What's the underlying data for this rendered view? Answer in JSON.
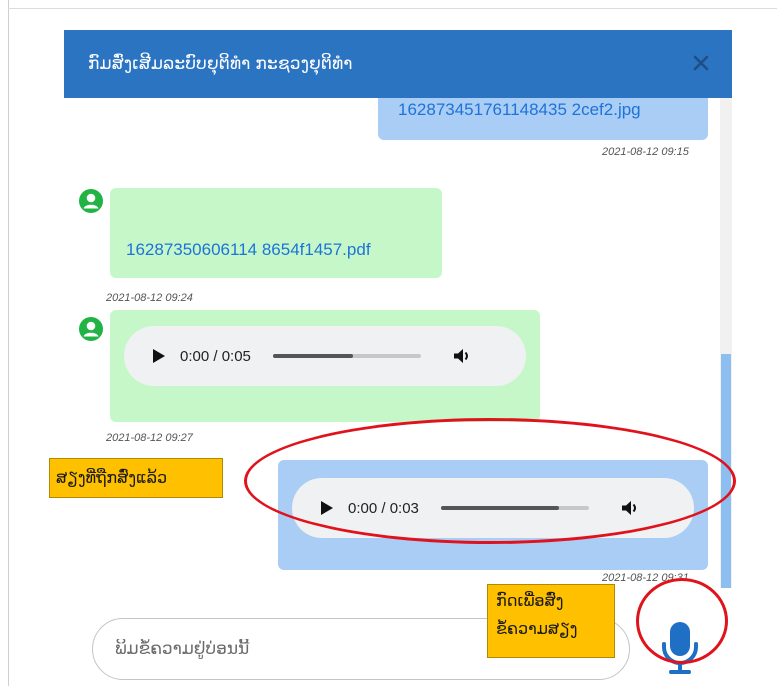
{
  "dialog": {
    "title": "ກົມສົ່ງເສີມລະບົບຍຸຕິທຳ ກະຊວງຍຸຕິທຳ",
    "close_icon": "close-icon",
    "header_color": "#2b74c2"
  },
  "messages": [
    {
      "direction": "sent",
      "kind": "file",
      "file_name": "162873451761148435 2cef2.jpg",
      "timestamp": "2021-08-12 09:15"
    },
    {
      "direction": "received",
      "kind": "file",
      "file_name": "16287350606114 8654f1457.pdf",
      "timestamp": "2021-08-12 09:24"
    },
    {
      "direction": "received",
      "kind": "audio",
      "time_display": "0:00 / 0:05",
      "buffered_fraction": 0.54,
      "timestamp": "2021-08-12 09:27"
    },
    {
      "direction": "sent",
      "kind": "audio",
      "time_display": "0:00 / 0:03",
      "buffered_fraction": 0.8,
      "timestamp": "2021-08-12 09:31"
    }
  ],
  "input": {
    "placeholder": "ພິມຂໍ້ຄວາມຢູ່ບ່ອນນີ້",
    "mic_icon": "microphone-icon"
  },
  "annotations": {
    "sent_voice_label": "ສຽງທີ່ຖືກສົ່ງແລ້ວ",
    "mic_hint_line1": "ກົດເພື່ອສົ່ງ",
    "mic_hint_line2": "ຂໍ້ຄວາມສຽງ",
    "highlight_color": "#e0121b",
    "callout_color": "#ffc000"
  },
  "colors": {
    "sent_bubble": "#a9cdf5",
    "received_bubble": "#c6f7c9",
    "link": "#1e73d8",
    "avatar": "#22b345"
  }
}
